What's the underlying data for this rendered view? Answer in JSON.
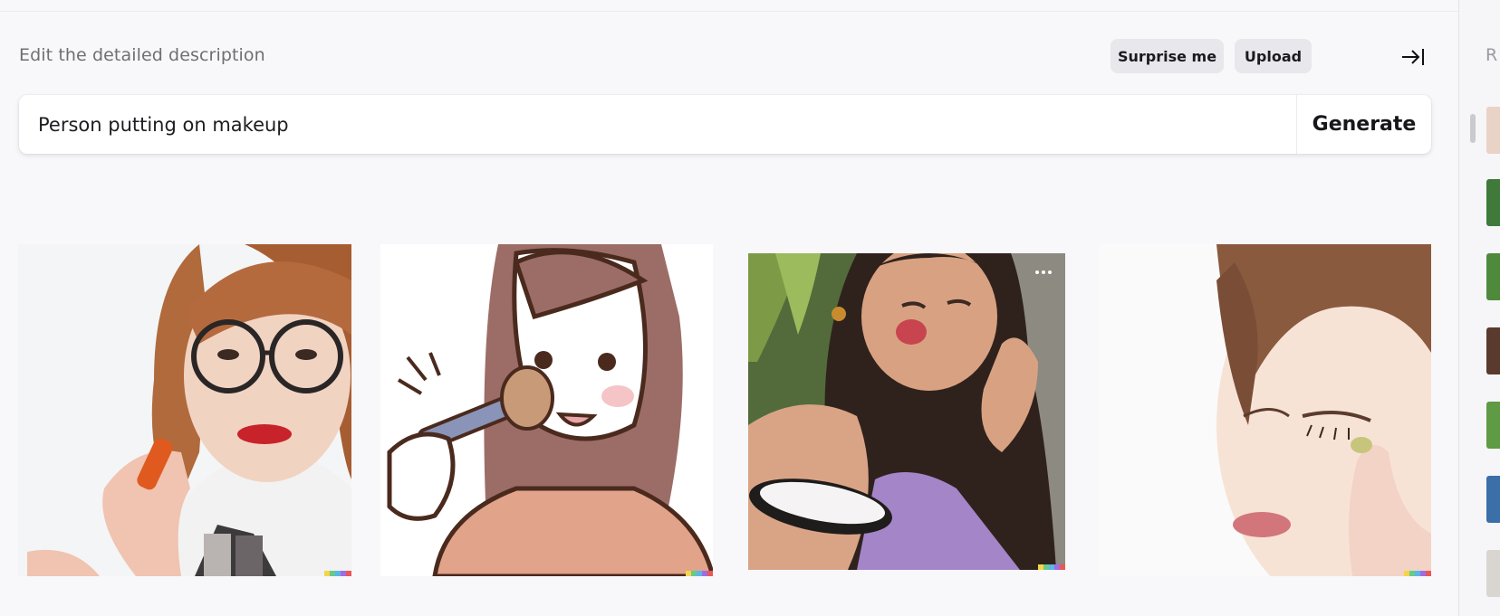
{
  "header": {
    "title": "Edit the detailed description",
    "surprise_label": "Surprise me",
    "upload_label": "Upload",
    "collapse_icon": "arrow-right-to-bar-icon"
  },
  "prompt": {
    "value": "Person putting on makeup",
    "generate_label": "Generate"
  },
  "results": [
    {
      "name": "woman-with-glasses-applying-lipstick",
      "style": "photo"
    },
    {
      "name": "cartoon-woman-with-makeup-brush",
      "style": "illustration"
    },
    {
      "name": "woman-with-compact-mirror",
      "style": "photo",
      "has_menu": true
    },
    {
      "name": "woman-applying-eyeshadow",
      "style": "photo"
    }
  ],
  "rail": {
    "letter": "R"
  },
  "colors": {
    "background": "#f8f8fa",
    "pill": "#e8e8ec",
    "text": "#1b1b1f",
    "muted": "#6f6f74",
    "watermark": [
      "#f5d547",
      "#68c98a",
      "#5ab6e6",
      "#a16ce0",
      "#e8575a"
    ]
  }
}
